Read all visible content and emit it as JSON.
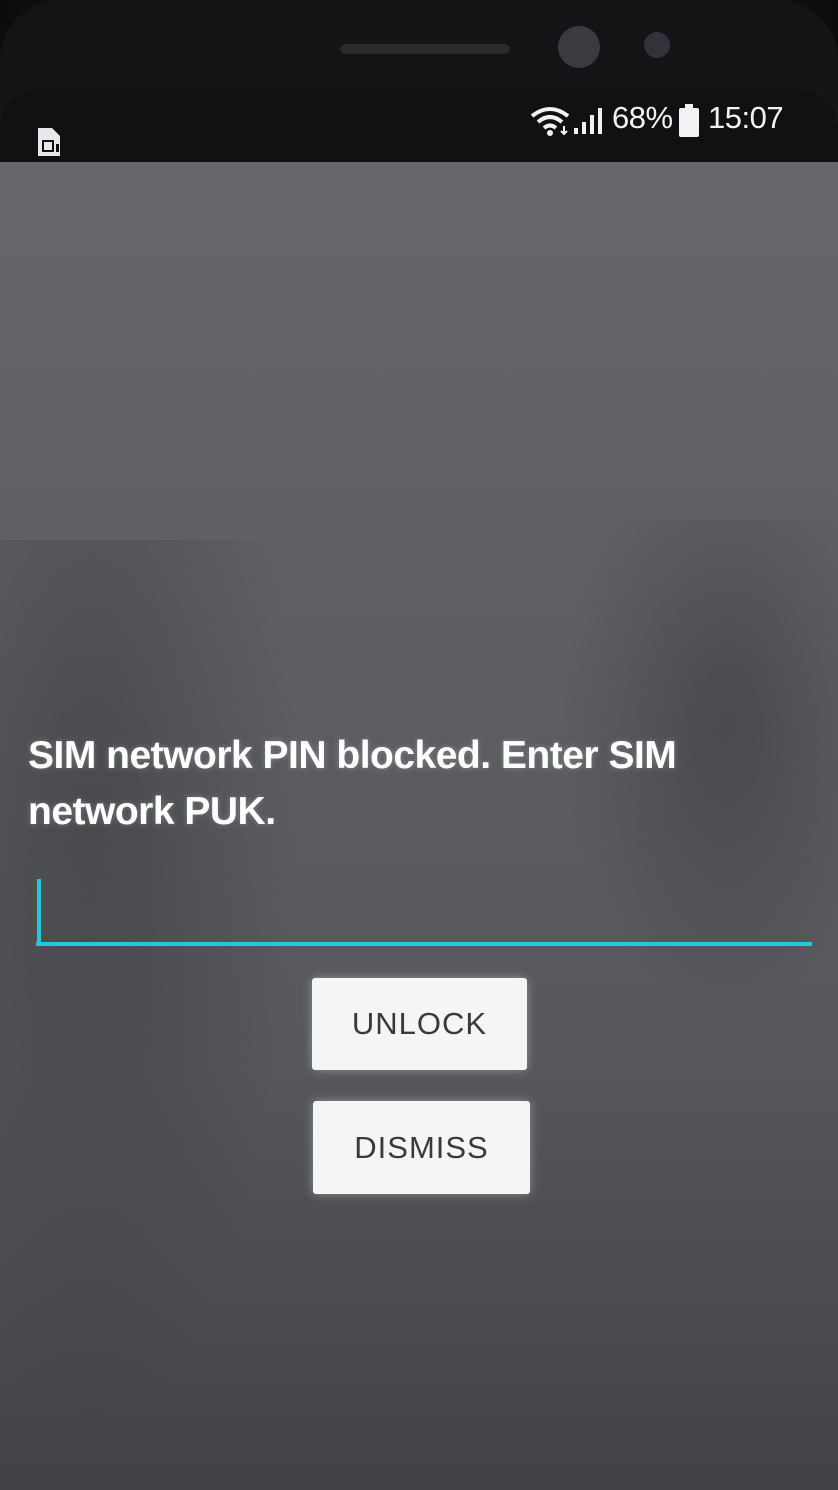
{
  "status_bar": {
    "sim_icon": "sim-card-alert-icon",
    "wifi_icon": "wifi-icon",
    "signal_icon": "cell-signal-icon",
    "battery_percent": "68%",
    "battery_icon": "battery-icon",
    "time": "15:07"
  },
  "dialog": {
    "message": "SIM network PIN blocked. Enter SIM network PUK.",
    "puk_input": {
      "value": "",
      "placeholder": ""
    },
    "unlock_label": "UNLOCK",
    "dismiss_label": "DISMISS"
  },
  "colors": {
    "accent": "#23c7de",
    "button_background": "#f5f5f5",
    "text_primary": "#ffffff"
  }
}
